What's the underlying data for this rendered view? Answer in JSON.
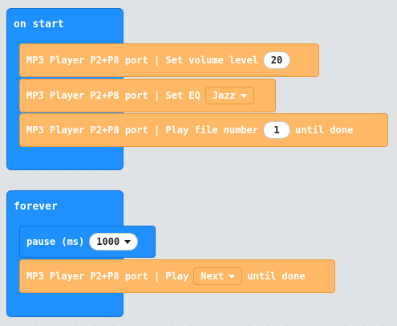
{
  "on_start": {
    "title": "on start",
    "blocks": [
      {
        "prefix": "MP3 Player P2+P8 port | Set volume level",
        "value": "20"
      },
      {
        "prefix": "MP3 Player P2+P8 port | Set EQ",
        "dropdown": "Jazz"
      },
      {
        "prefix": "MP3 Player P2+P8 port | Play file number",
        "value": "1",
        "suffix": "until done"
      }
    ]
  },
  "forever": {
    "title": "forever",
    "pause": {
      "label": "pause (ms)",
      "value": "1000"
    },
    "play": {
      "prefix": "MP3 Player P2+P8 port | Play",
      "dropdown": "Next",
      "suffix": "until done"
    }
  },
  "colors": {
    "event_blue": "#1e90ff",
    "mp3_orange": "#ffb865"
  },
  "icons": {
    "dropdown": "caret-down-icon"
  }
}
